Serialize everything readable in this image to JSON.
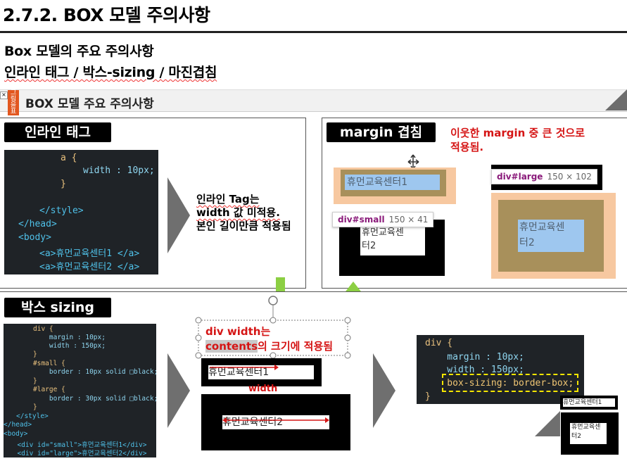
{
  "page": {
    "title": "2.7.2. BOX 모델 주의사항",
    "subtitle1": "Box 모델의 주요 주의사항",
    "subtitle2": "인라인 태그 / 박스-sizing / 마진겹침"
  },
  "header_bar": {
    "label": "BOX 모델 주요 주의사항",
    "close_glyph": "×",
    "side_tab_text": "그 림 을 표",
    "side_tab_extra": "수"
  },
  "inline_panel": {
    "pill": "인라인 태그",
    "code_lines": [
      {
        "text": "a {",
        "cls": "sel"
      },
      {
        "text": "width : 10px;",
        "cls": "prop"
      },
      {
        "text": "}",
        "cls": "sel"
      },
      {
        "text": "</style>",
        "cls": "tag"
      },
      {
        "text": "</head>",
        "cls": "tag"
      },
      {
        "text": "<body>",
        "cls": "tag"
      },
      {
        "text": "<a>휴먼교육센터1 </a>",
        "cls": "tag"
      },
      {
        "text": "<a>휴먼교육센터2 </a>",
        "cls": "tag"
      }
    ],
    "note_line1": "인라인 Tag는",
    "note_line2": "width 값 미적용.",
    "note_line3": "본인 길이만큼 적용됨"
  },
  "margin_panel": {
    "pill": "margin 겹침",
    "note_line1": "이웃한 margin 중 큰 것으로",
    "note_line2": "적용됨.",
    "small_box_text1": "휴먼교육센터1",
    "small_box_text2": "휴먼교육센",
    "small_box_text3": "터2",
    "tip_small_name": "div#small",
    "tip_small_size": "150 × 41",
    "tip_large_name": "div#large",
    "tip_large_size": "150 × 102",
    "large_box_text1": "휴먼교육센",
    "large_box_text2": "터2"
  },
  "sizing_panel": {
    "pill": "박스 sizing",
    "code_lines": [
      "div {",
      "    margin : 10px;",
      "    width : 150px;",
      "}",
      "#small {",
      "    border : 10px solid □black;",
      "}",
      "#large {",
      "    border : 30px solid □black;",
      "}",
      "</style>",
      "</head>",
      "<body>",
      "  <div id=\"small\">휴먼교육센터1</div>",
      "  <div id=\"large\">휴먼교육센터2</div>"
    ],
    "note_line1": "div width는",
    "note_word": "contents",
    "note_rest": "의 크기에 적용됨",
    "demo_box1": "휴먼교육센터1",
    "width_label": "width",
    "demo_box2": "휴먼교육센터2",
    "code2_lines": [
      "div {",
      "    margin : 10px;",
      "    width : 150px;",
      "    box-sizing: border-box;",
      "}"
    ],
    "result_box1": "휴먼교육센터1",
    "result_box2a": "휴먼교육센",
    "result_box2b": "터2"
  },
  "colors": {
    "accent_red": "#d51515",
    "code_bg": "#1f2327",
    "margin_peach": "#f7c8a0",
    "border_olive": "#a8905b",
    "content_blue": "#9ec7ef",
    "arrow_green": "#8ccf43"
  }
}
